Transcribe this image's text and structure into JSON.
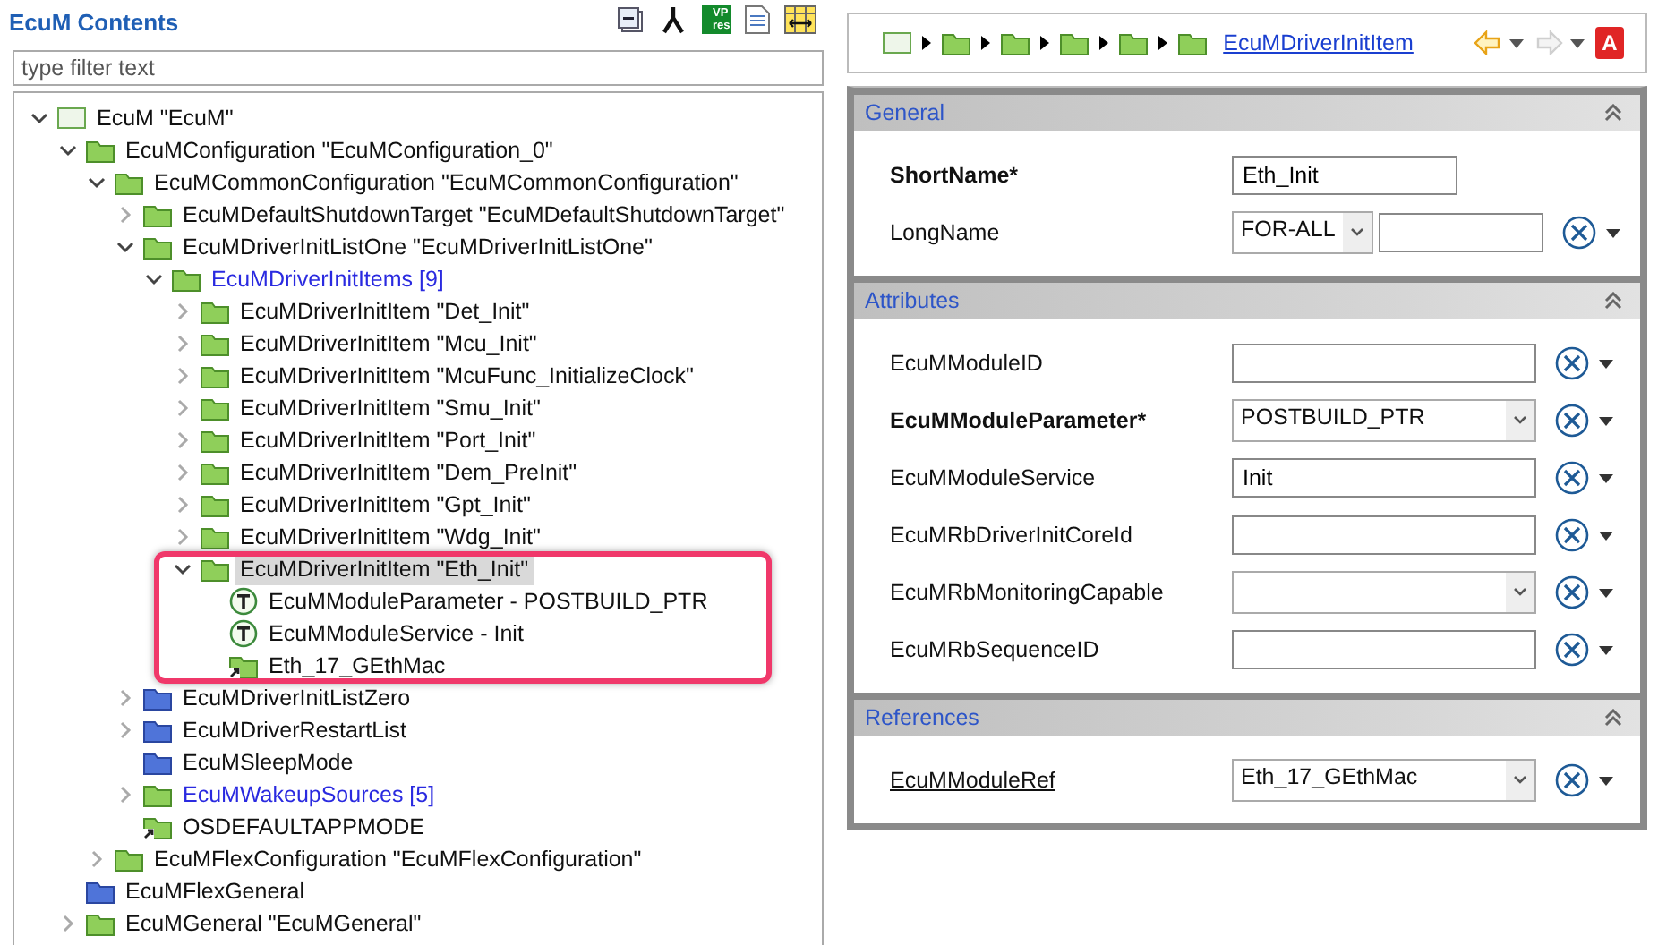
{
  "left": {
    "title": "EcuM Contents",
    "toolbar": [
      {
        "kind": "collapse"
      },
      {
        "kind": "fork"
      },
      {
        "kind": "badge",
        "text": "VP res"
      },
      {
        "kind": "doc"
      },
      {
        "kind": "columns"
      }
    ],
    "filter": {
      "placeholder": "type filter text"
    },
    "tree": [
      {
        "label": "EcuM \"EcuM\"",
        "kind": "module",
        "expanded": true,
        "selected": false,
        "children": [
          {
            "label": "EcuMConfiguration \"EcuMConfiguration_0\"",
            "kind": "folder",
            "expanded": true,
            "selected": false,
            "children": [
              {
                "label": "EcuMCommonConfiguration \"EcuMCommonConfiguration\"",
                "kind": "folder",
                "expanded": true,
                "selected": false,
                "children": [
                  {
                    "label": "EcuMDefaultShutdownTarget \"EcuMDefaultShutdownTarget\"",
                    "kind": "folder",
                    "expanded": false,
                    "selected": false
                  },
                  {
                    "label": "EcuMDriverInitListOne \"EcuMDriverInitListOne\"",
                    "kind": "folder",
                    "expanded": true,
                    "selected": false,
                    "children": [
                      {
                        "label": "EcuMDriverInitItems [9]",
                        "kind": "list-folder",
                        "expanded": true,
                        "selected": false,
                        "children": [
                          {
                            "label": "EcuMDriverInitItem \"Det_Init\"",
                            "kind": "folder",
                            "expanded": false,
                            "selected": false
                          },
                          {
                            "label": "EcuMDriverInitItem \"Mcu_Init\"",
                            "kind": "folder",
                            "expanded": false,
                            "selected": false
                          },
                          {
                            "label": "EcuMDriverInitItem \"McuFunc_InitializeClock\"",
                            "kind": "folder",
                            "expanded": false,
                            "selected": false
                          },
                          {
                            "label": "EcuMDriverInitItem \"Smu_Init\"",
                            "kind": "folder",
                            "expanded": false,
                            "selected": false
                          },
                          {
                            "label": "EcuMDriverInitItem \"Port_Init\"",
                            "kind": "folder",
                            "expanded": false,
                            "selected": false
                          },
                          {
                            "label": "EcuMDriverInitItem \"Dem_PreInit\"",
                            "kind": "folder",
                            "expanded": false,
                            "selected": false
                          },
                          {
                            "label": "EcuMDriverInitItem \"Gpt_Init\"",
                            "kind": "folder",
                            "expanded": false,
                            "selected": false
                          },
                          {
                            "label": "EcuMDriverInitItem \"Wdg_Init\"",
                            "kind": "folder",
                            "expanded": false,
                            "selected": false
                          },
                          {
                            "label": "EcuMDriverInitItem \"Eth_Init\"",
                            "kind": "folder",
                            "expanded": true,
                            "selected": true,
                            "annotated": true,
                            "children": [
                              {
                                "label": "EcuMModuleParameter - POSTBUILD_PTR",
                                "kind": "parameter",
                                "selected": false
                              },
                              {
                                "label": "EcuMModuleService - Init",
                                "kind": "parameter",
                                "selected": false
                              },
                              {
                                "label": "Eth_17_GEthMac",
                                "kind": "reference",
                                "selected": false
                              }
                            ]
                          }
                        ]
                      }
                    ]
                  },
                  {
                    "label": "EcuMDriverInitListZero",
                    "kind": "plain-folder",
                    "expanded": false,
                    "selected": false
                  },
                  {
                    "label": "EcuMDriverRestartList",
                    "kind": "plain-folder",
                    "expanded": false,
                    "selected": false
                  },
                  {
                    "label": "EcuMSleepMode",
                    "kind": "plain-folder",
                    "selected": false
                  },
                  {
                    "label": "EcuMWakeupSources [5]",
                    "kind": "list-folder",
                    "expanded": false,
                    "selected": false
                  },
                  {
                    "label": "OSDEFAULTAPPMODE",
                    "kind": "reference",
                    "selected": false
                  }
                ]
              },
              {
                "label": "EcuMFlexConfiguration \"EcuMFlexConfiguration\"",
                "kind": "folder",
                "expanded": false,
                "selected": false
              }
            ]
          },
          {
            "label": "EcuMFlexGeneral",
            "kind": "plain-folder",
            "selected": false
          },
          {
            "label": "EcuMGeneral \"EcuMGeneral\"",
            "kind": "folder",
            "expanded": false,
            "selected": false
          }
        ]
      }
    ]
  },
  "right": {
    "breadcrumb": {
      "icons": [
        {
          "kind": "module"
        },
        {
          "kind": "folder"
        },
        {
          "kind": "folder"
        },
        {
          "kind": "folder"
        },
        {
          "kind": "folder"
        },
        {
          "kind": "folder"
        }
      ],
      "link": "EcuMDriverInitItem"
    },
    "nav": {
      "back_enabled": true,
      "forward_enabled": false,
      "badge": "A"
    },
    "sections": [
      {
        "title": "General",
        "fields": [
          {
            "label": "ShortName*",
            "required": true,
            "linked": false,
            "kind": "text",
            "value": "Eth_Init",
            "actions": false
          },
          {
            "label": "LongName",
            "required": false,
            "linked": false,
            "kind": "lang",
            "language": "FOR-ALL",
            "actions": true
          }
        ]
      },
      {
        "title": "Attributes",
        "fields": [
          {
            "label": "EcuMModuleID",
            "required": false,
            "linked": false,
            "kind": "text",
            "actions": true
          },
          {
            "label": "EcuMModuleParameter*",
            "required": true,
            "linked": false,
            "kind": "combo",
            "value": "POSTBUILD_PTR",
            "actions": true
          },
          {
            "label": "EcuMModuleService",
            "required": false,
            "linked": false,
            "kind": "text",
            "value": "Init",
            "actions": true
          },
          {
            "label": "EcuMRbDriverInitCoreId",
            "required": false,
            "linked": false,
            "kind": "text",
            "actions": true
          },
          {
            "label": "EcuMRbMonitoringCapable",
            "required": false,
            "linked": false,
            "kind": "combo",
            "actions": true
          },
          {
            "label": "EcuMRbSequenceID",
            "required": false,
            "linked": false,
            "kind": "text",
            "actions": true
          }
        ]
      },
      {
        "title": "References",
        "fields": [
          {
            "label": "EcuMModuleRef",
            "required": false,
            "linked": true,
            "kind": "combo",
            "value": "Eth_17_GEthMac",
            "actions": true
          }
        ]
      }
    ]
  }
}
